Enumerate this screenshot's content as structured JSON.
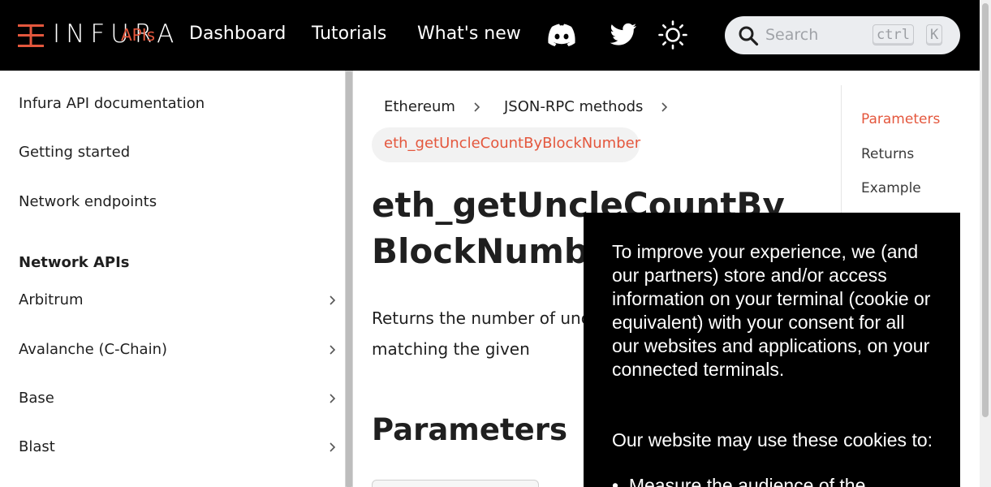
{
  "navbar": {
    "logo_text": "INFURA",
    "apis_label": "APIs",
    "links": [
      "Dashboard",
      "Tutorials",
      "What's new"
    ],
    "search": {
      "placeholder": "Search",
      "key1": "ctrl",
      "key2": "K"
    }
  },
  "sidebar": {
    "items": [
      "Infura API documentation",
      "Getting started",
      "Network endpoints"
    ],
    "section_title": "Network APIs",
    "networks": [
      "Arbitrum",
      "Avalanche (C-Chain)",
      "Base",
      "Blast"
    ]
  },
  "breadcrumb": {
    "items": [
      "Ethereum",
      "JSON-RPC methods"
    ],
    "current": "eth_getUncleCountByBlockNumber"
  },
  "main": {
    "title": "eth_getUncleCountByBlockNumber",
    "description": "Returns the number of uncles in a block from a block matching the given",
    "section_parameters": "Parameters"
  },
  "toc": {
    "items": [
      "Parameters",
      "Returns",
      "Example"
    ],
    "active": "Parameters"
  },
  "cookie": {
    "text1": "To improve your experience, we (and our partners) store and/or access information on your terminal (cookie or equivalent) with your consent for all our websites and applications, on your connected terminals.",
    "text2": "Our website may use these cookies to:",
    "bullet1": "Measure the audience of the"
  },
  "colors": {
    "accent": "#e4573d",
    "navbar_bg": "#000000",
    "cookie_bg": "#000000"
  }
}
